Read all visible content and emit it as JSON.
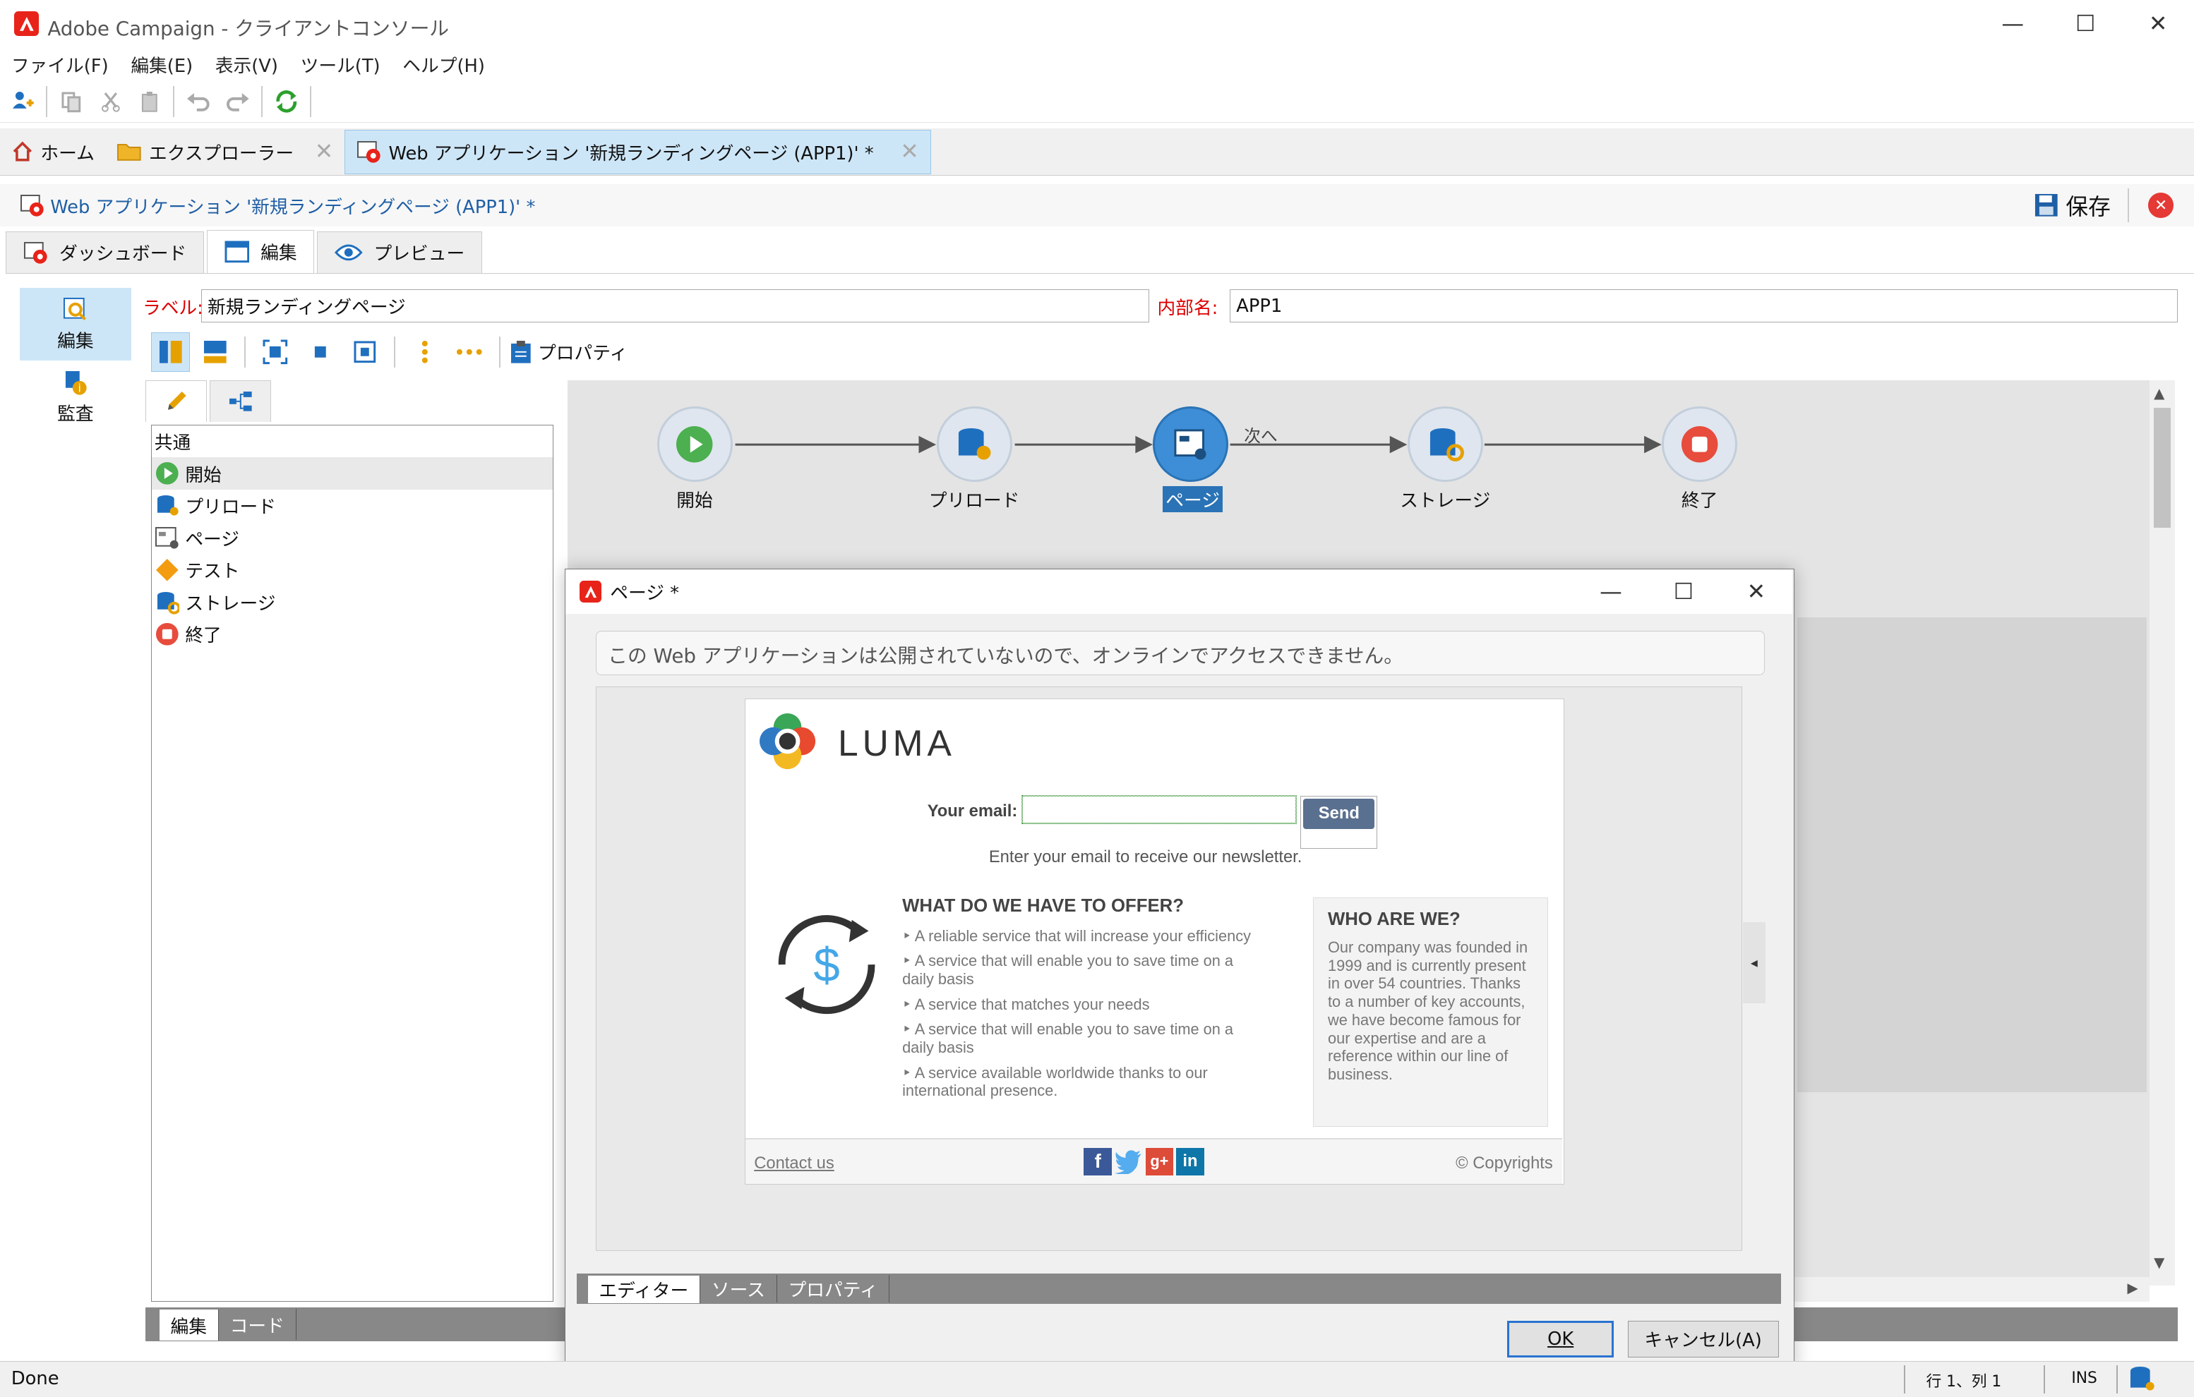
{
  "window": {
    "title": "Adobe Campaign - クライアントコンソール"
  },
  "menu": [
    "ファイル(F)",
    "編集(E)",
    "表示(V)",
    "ツール(T)",
    "ヘルプ(H)"
  ],
  "tabs": {
    "home": "ホーム",
    "explorer": "エクスプローラー",
    "webapp": "Web アプリケーション '新規ランディングページ (APP1)' *"
  },
  "header": {
    "title": "Web アプリケーション '新規ランディングページ (APP1)' *",
    "save": "保存"
  },
  "subtabs": {
    "dashboard": "ダッシュボード",
    "edit": "編集",
    "preview": "プレビュー"
  },
  "leftnav": {
    "edit": "編集",
    "audit": "監査"
  },
  "form": {
    "label_caption": "ラベル:",
    "label_value": "新規ランディングページ",
    "internal_caption": "内部名:",
    "internal_value": "APP1"
  },
  "edit_toolbar": {
    "properties": "プロパティ"
  },
  "activities": {
    "group": "共通",
    "items": [
      "開始",
      "プリロード",
      "ページ",
      "テスト",
      "ストレージ",
      "終了"
    ]
  },
  "bottom_tabs": {
    "edit": "編集",
    "code": "コード"
  },
  "workflow": {
    "nodes": [
      "開始",
      "プリロード",
      "ページ",
      "ストレージ",
      "終了"
    ],
    "transition": "次へ"
  },
  "dialog": {
    "title": "ページ *",
    "notice": "この Web アプリケーションは公開されていないので、オンラインでアクセスできません。",
    "tabs": [
      "エディター",
      "ソース",
      "プロパティ"
    ],
    "ok": "OK",
    "cancel": "キャンセル(A)"
  },
  "luma": {
    "brand": "LUMA",
    "email_label": "Your email:",
    "send": "Send",
    "subtitle": "Enter your email to receive our newsletter.",
    "offer_title": "WHAT DO WE HAVE TO OFFER?",
    "offer_items": [
      "A reliable service that will increase your efficiency",
      "A service that will enable you to save time on a daily basis",
      "A service that matches your needs",
      "A service that will enable you to save time on a daily basis",
      "A service available worldwide thanks to our international presence."
    ],
    "who_title": "WHO ARE WE?",
    "who_text": "Our company was founded in 1999 and is currently present in over 54 countries. Thanks to a number of key accounts, we have become famous for our expertise and are a reference within our line of business.",
    "contact": "Contact us",
    "copyright": "© Copyrights"
  },
  "statusbar": {
    "left": "Done",
    "pos": "行 1、列 1",
    "mode": "INS"
  },
  "colors": {
    "accent": "#3d8ed6",
    "adobe_red": "#e8231a",
    "selected_tab": "#cde6f7"
  }
}
